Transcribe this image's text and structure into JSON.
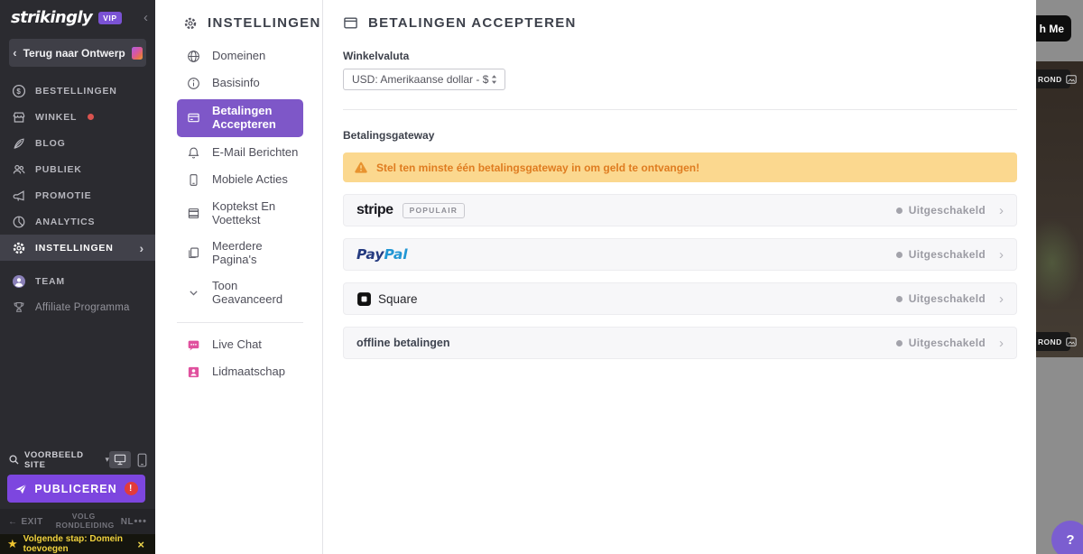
{
  "colors": {
    "sidebar_bg": "#2b2b30",
    "accent_purple": "#7e57c8",
    "publish_purple": "#7d46df",
    "vip_purple": "#7a52d4",
    "warning_bg": "#fbd88f",
    "warning_text": "#df7c20",
    "pink": "#e0519e",
    "red_dot": "#d9534f",
    "error_red": "#e23b3b",
    "notification_yellow": "#f0d23e",
    "help_purple": "#7b5ed0",
    "paypal_navy": "#253b80",
    "paypal_blue": "#2196d4"
  },
  "left_sidebar": {
    "logo": "strikingly",
    "vip_badge": "VIP",
    "collapse": "‹",
    "back_button": "Terug naar Ontwerp",
    "items": [
      {
        "label": "BESTELLINGEN"
      },
      {
        "label": "WINKEL"
      },
      {
        "label": "BLOG"
      },
      {
        "label": "PUBLIEK"
      },
      {
        "label": "PROMOTIE"
      },
      {
        "label": "ANALYTICS"
      },
      {
        "label": "INSTELLINGEN"
      },
      {
        "label": "TEAM"
      },
      {
        "label": "Affiliate Programma"
      }
    ],
    "preview_label": "VOORBEELD SITE",
    "publish_label": "PUBLICEREN",
    "publish_alert": "!",
    "footer": {
      "exit": "EXIT",
      "tour": "VOLG RONDLEIDING",
      "lang": "NL",
      "more": "•••"
    },
    "notification": {
      "text": "Volgende stap: Domein toevoegen",
      "close": "×",
      "star": "★"
    }
  },
  "settings_menu": {
    "title": "INSTELLINGEN",
    "items": [
      {
        "label": "Domeinen"
      },
      {
        "label": "Basisinfo"
      },
      {
        "label": "Betalingen Accepteren"
      },
      {
        "label": "E-Mail Berichten"
      },
      {
        "label": "Mobiele Acties"
      },
      {
        "label": "Koptekst En Voettekst"
      },
      {
        "label": "Meerdere Pagina's"
      },
      {
        "label": "Toon Geavanceerd"
      },
      {
        "label": "Live Chat"
      },
      {
        "label": "Lidmaatschap"
      }
    ]
  },
  "main": {
    "title": "BETALINGEN ACCEPTEREN",
    "currency_label": "Winkelvaluta",
    "currency_value": "USD: Amerikaanse dollar - $",
    "gateway_section_label": "Betalingsgateway",
    "warning_text": "Stel ten minste één betalingsgateway in om geld te ontvangen!",
    "gateways": {
      "stripe": {
        "name": "stripe",
        "badge": "POPULAIR",
        "status": "Uitgeschakeld"
      },
      "paypal": {
        "name_pay": "Pay",
        "name_pal": "Pal",
        "status": "Uitgeschakeld"
      },
      "square": {
        "name": "Square",
        "status": "Uitgeschakeld"
      },
      "offline": {
        "name": "offline betalingen",
        "status": "Uitgeschakeld"
      }
    },
    "chevron": "›"
  },
  "site_preview": {
    "cta_button": "h Me",
    "background_badge": "ROND",
    "help": "?"
  }
}
